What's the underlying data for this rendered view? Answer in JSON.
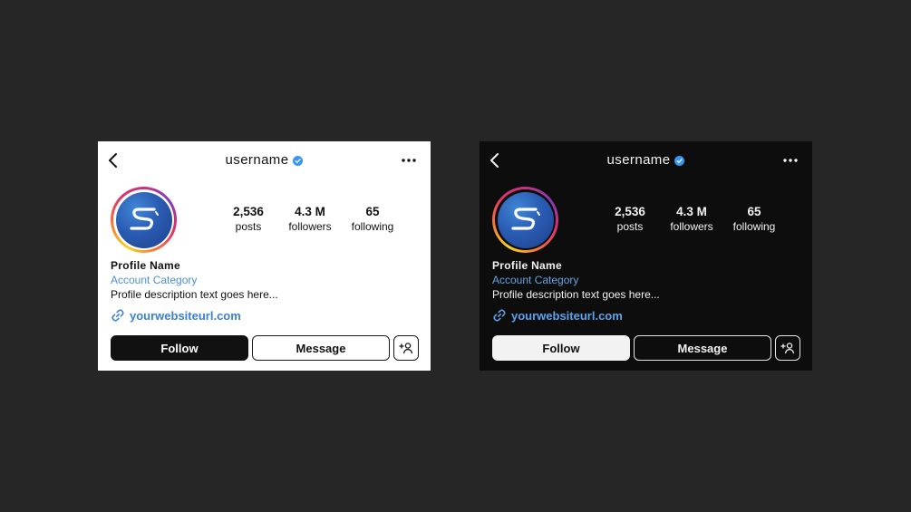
{
  "colors": {
    "page_background": "#262626",
    "light_card_background": "#ffffff",
    "dark_card_background": "#0d0d0d",
    "verified_badge": "#3897f0",
    "link_color": "#3b7fd1"
  },
  "icons": {
    "back": "chevron-left-icon",
    "verified": "verified-badge-icon",
    "more": "more-horizontal-icon",
    "avatar_logo": "s-logo-icon",
    "link": "link-icon",
    "add_user": "add-user-icon"
  },
  "cards": [
    {
      "theme": "light",
      "header": {
        "username": "username"
      },
      "stats": {
        "posts": {
          "value": "2,536",
          "label": "posts"
        },
        "followers": {
          "value": "4.3 M",
          "label": "followers"
        },
        "following": {
          "value": "65",
          "label": "following"
        }
      },
      "profile": {
        "name": "Profile Name",
        "category": "Account Category",
        "description": "Profile description text goes here...",
        "website": "yourwebsiteurl.com"
      },
      "actions": {
        "follow": "Follow",
        "message": "Message"
      }
    },
    {
      "theme": "dark",
      "header": {
        "username": "username"
      },
      "stats": {
        "posts": {
          "value": "2,536",
          "label": "posts"
        },
        "followers": {
          "value": "4.3 M",
          "label": "followers"
        },
        "following": {
          "value": "65",
          "label": "following"
        }
      },
      "profile": {
        "name": "Profile Name",
        "category": "Account Category",
        "description": "Profile description text goes here...",
        "website": "yourwebsiteurl.com"
      },
      "actions": {
        "follow": "Follow",
        "message": "Message"
      }
    }
  ]
}
